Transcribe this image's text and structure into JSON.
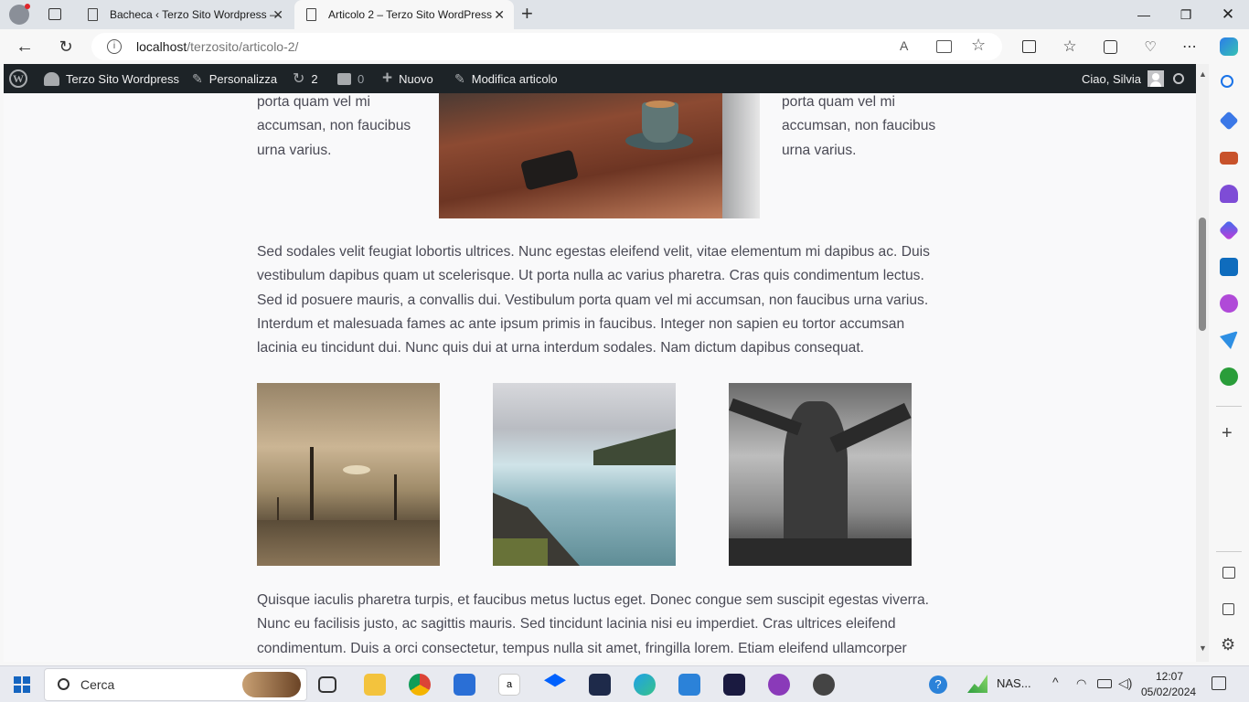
{
  "browser": {
    "tabs": [
      {
        "title": "Bacheca ‹ Terzo Sito Wordpress —",
        "active": false
      },
      {
        "title": "Articolo 2 – Terzo Sito WordPress",
        "active": true
      }
    ],
    "url_host": "localhost",
    "url_path": "/terzosito/articolo-2/"
  },
  "adminbar": {
    "site_name": "Terzo Sito Wordpress",
    "customize": "Personalizza",
    "updates": "2",
    "comments": "0",
    "new": "Nuovo",
    "edit": "Modifica articolo",
    "greeting": "Ciao, Silvia"
  },
  "article": {
    "side_text_left": "porta quam vel mi accumsan, non faucibus urna varius.",
    "side_text_right": "porta quam vel mi accumsan, non faucibus urna varius.",
    "paragraph_1": "Sed sodales velit feugiat lobortis ultrices. Nunc egestas eleifend velit, vitae elementum mi dapibus ac. Duis vestibulum dapibus quam ut scelerisque. Ut porta nulla ac varius pharetra. Cras quis condimentum lectus. Sed id posuere mauris, a convallis dui. Vestibulum porta quam vel mi accumsan, non faucibus urna varius. Interdum et malesuada fames ac ante ipsum primis in faucibus. Integer non sapien eu tortor accumsan lacinia eu tincidunt dui. Nunc quis dui at urna interdum sodales. Nam dictum dapibus consequat.",
    "paragraph_2": "Quisque iaculis pharetra turpis, et faucibus metus luctus eget. Donec congue sem suscipit egestas viverra. Nunc eu facilisis justo, ac sagittis mauris. Sed tincidunt lacinia nisi eu imperdiet. Cras ultrices eleifend condimentum. Duis a orci consectetur, tempus nulla sit amet, fringilla lorem. Etiam eleifend ullamcorper"
  },
  "taskbar": {
    "search_placeholder": "Cerca",
    "tray_label": "NAS...",
    "time": "12:07",
    "date": "05/02/2024"
  }
}
